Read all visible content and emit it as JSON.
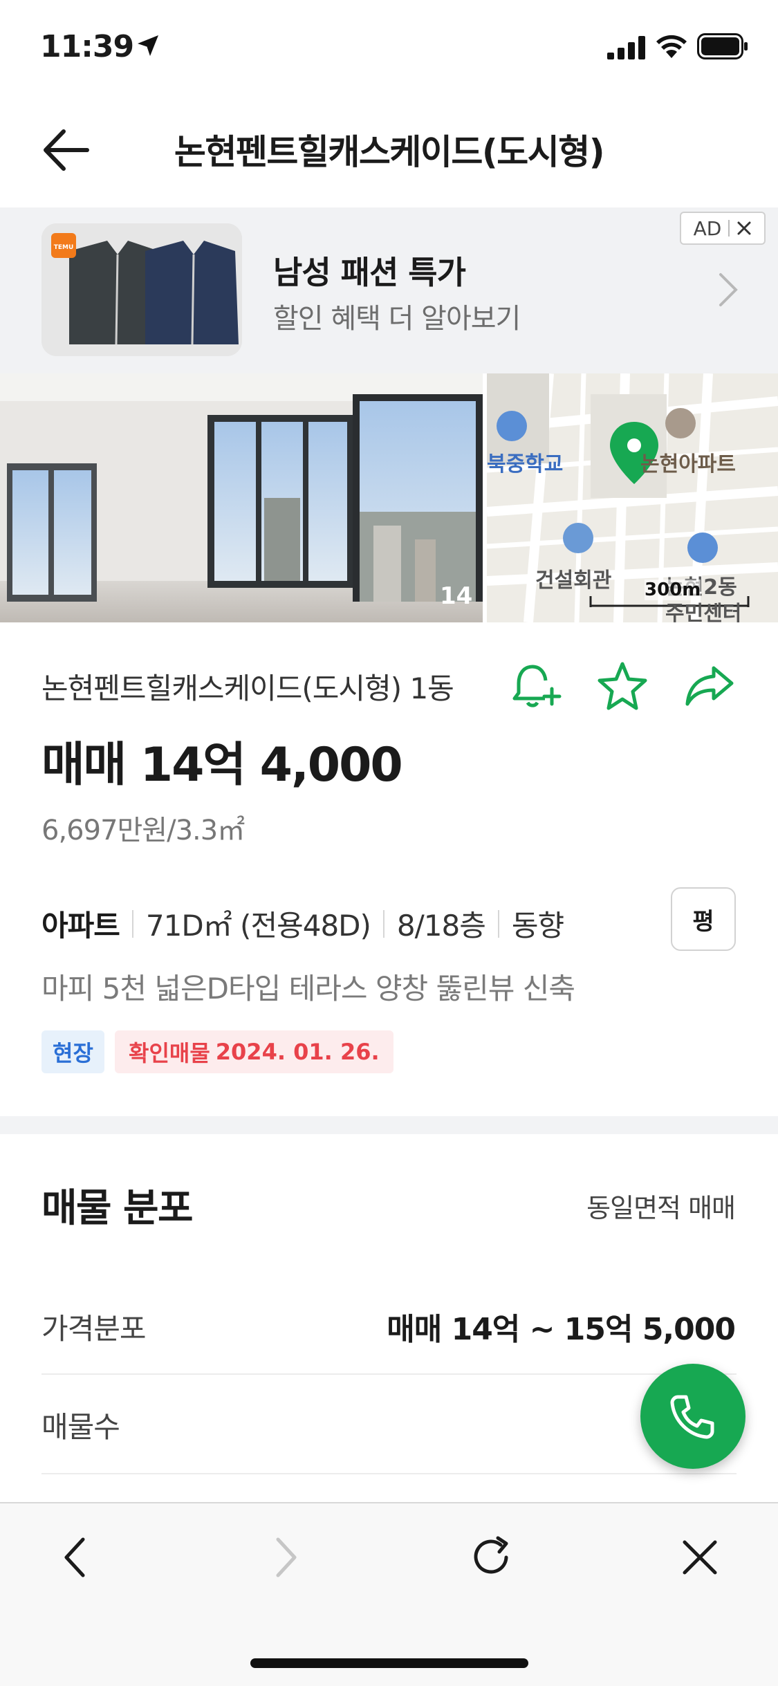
{
  "status_bar": {
    "time": "11:39"
  },
  "header": {
    "title": "논현펜트힐캐스케이드(도시형)"
  },
  "ad": {
    "title": "남성 패션 특가",
    "subtitle": "할인 혜택 더 알아보기",
    "tag": "AD",
    "brand_badge": "TEMU"
  },
  "gallery": {
    "photo_count": "14",
    "map_labels": [
      "북중학교",
      "논현아파트",
      "건설회관",
      "논현2동",
      "주민센터"
    ],
    "map_scale": "300m"
  },
  "listing": {
    "name": "논현펜트힐캐스케이드(도시형) 1동",
    "price": "매매 14억 4,000",
    "price_per_unit": "6,697만원/3.3㎡",
    "specs": {
      "type": "아파트",
      "area": "71D㎡ (전용48D)",
      "floor": "8/18층",
      "direction": "동향"
    },
    "unit_toggle": "평",
    "description": "마피 5천 넓은D타입 테라스 양창 뚫린뷰 신축",
    "badge_site": "현장",
    "badge_verified_label": "확인매물",
    "badge_verified_date": "2024. 01. 26."
  },
  "distribution": {
    "title": "매물 분포",
    "filter_link": "동일면적 매매",
    "rows": [
      {
        "label": "가격분포",
        "value": "매매 14억 ~ 15억 5,000"
      },
      {
        "label": "매물수",
        "value": ""
      }
    ]
  },
  "colors": {
    "accent_green": "#17a852",
    "badge_blue": "#2a6fd6",
    "badge_red": "#e8424a"
  },
  "icons": {
    "alert": "bell-plus-icon",
    "favorite": "star-icon",
    "share": "share-arrow-icon",
    "call": "phone-icon"
  }
}
